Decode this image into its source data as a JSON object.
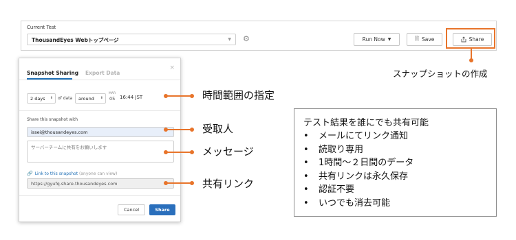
{
  "toolbar": {
    "label": "Current Test",
    "test_name": "ThousandEyes Webトップページ",
    "run_now": "Run Now",
    "save": "Save",
    "share": "Share"
  },
  "share_caption": "スナップショットの作成",
  "dialog": {
    "tab_snapshot": "Snapshot Sharing",
    "tab_export": "Export Data",
    "close": "×",
    "days_value": "2 days",
    "of_data": "of data",
    "around_value": "around",
    "date_month": "MAR",
    "date_day": "05",
    "time": "16:44 JST",
    "share_with_label": "Share this snapshot with",
    "email_value": "issei@thousandeyes.com",
    "message_value": "サーバーチームに共有をお願いします",
    "link_label": "Link to this snapshot",
    "link_note": "(anyone can view)",
    "link_url": "https://gyufq.share.thousandeyes.com",
    "cancel": "Cancel",
    "share": "Share"
  },
  "annotations": {
    "time_range": "時間範囲の指定",
    "recipient": "受取人",
    "message": "メッセージ",
    "shared_link": "共有リンク"
  },
  "info": {
    "title": "テスト結果を誰にでも共有可能",
    "bullet": "•",
    "items": [
      "メールにてリンク通知",
      "読取り専用",
      "1時間～２日間のデータ",
      "共有リンクは永久保存",
      "認証不要",
      "いつでも消去可能"
    ]
  },
  "colors": {
    "accent_orange": "#e8742a",
    "primary_blue": "#2a6fbc",
    "email_highlight": "#e8effa"
  },
  "icons": {
    "gear": "gear-icon",
    "dropdown": "chevron-down-icon",
    "save": "save-icon",
    "share": "share-icon",
    "link": "link-icon",
    "close": "close-icon"
  }
}
